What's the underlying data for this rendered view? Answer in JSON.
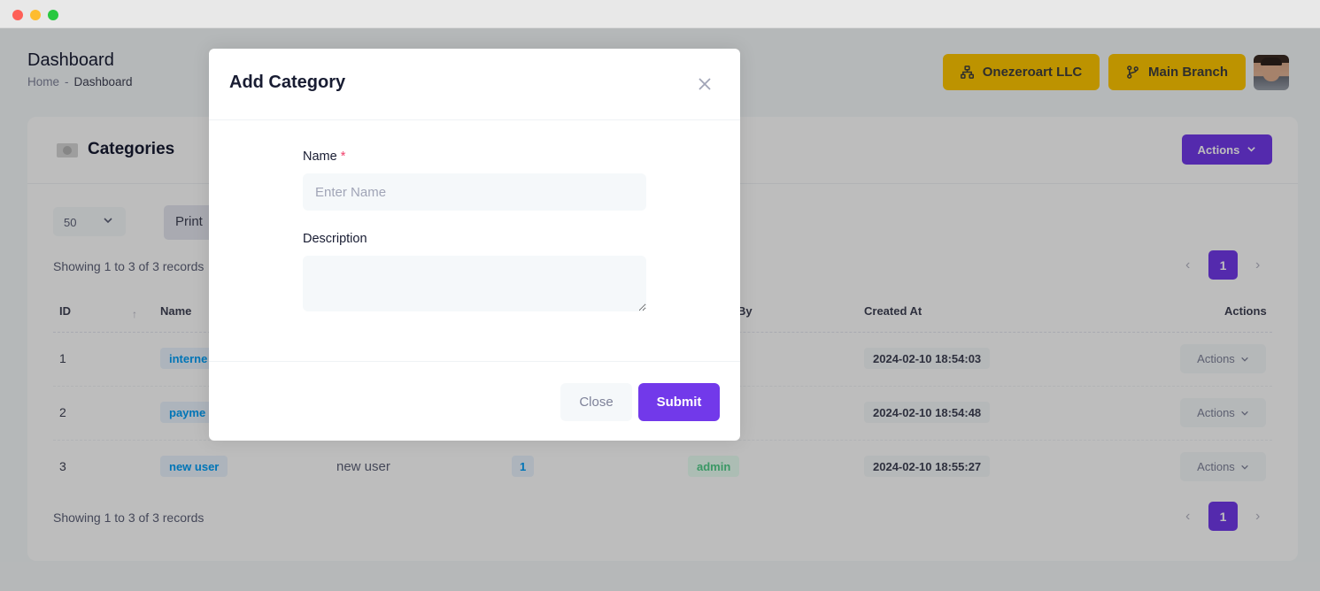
{
  "header": {
    "title": "Dashboard",
    "breadcrumb": {
      "home": "Home",
      "separator": "-",
      "current": "Dashboard"
    },
    "company_label": "Onezeroart LLC",
    "branch_label": "Main Branch"
  },
  "card": {
    "title": "Categories",
    "actions_label": "Actions"
  },
  "toolbar": {
    "page_size": "50",
    "print_label": "Print"
  },
  "summary": {
    "top": "Showing 1 to 3 of 3 records",
    "bottom": "Showing 1 to 3 of 3 records"
  },
  "pagination": {
    "current_page": "1"
  },
  "table": {
    "columns": [
      "ID",
      "Name",
      "By",
      "Created At",
      "Actions"
    ],
    "rows": [
      {
        "id": "1",
        "name": "interne",
        "description": "",
        "count": "",
        "created_by": "",
        "created_at": "2024-02-10 18:54:03",
        "action": "Actions"
      },
      {
        "id": "2",
        "name": "payme",
        "description": "",
        "count": "",
        "created_by": "",
        "created_at": "2024-02-10 18:54:48",
        "action": "Actions"
      },
      {
        "id": "3",
        "name": "new user",
        "description": "new user",
        "count": "1",
        "created_by": "admin",
        "created_at": "2024-02-10 18:55:27",
        "action": "Actions"
      }
    ]
  },
  "modal": {
    "title": "Add Category",
    "name_label": "Name",
    "required_mark": "*",
    "name_placeholder": "Enter Name",
    "name_value": "",
    "description_label": "Description",
    "description_value": "",
    "close_label": "Close",
    "submit_label": "Submit"
  },
  "colors": {
    "primary": "#7239ea",
    "warning": "#ffc700",
    "info": "#009ef7",
    "success": "#50cd89",
    "danger": "#f1416c"
  },
  "icons": {
    "company": "sitemap-icon",
    "branch": "git-branch-icon",
    "card": "category-image-icon",
    "close": "close-icon",
    "chevron": "chevron-down-icon",
    "sort": "sort-up-icon",
    "prev": "chevron-left-icon",
    "next": "chevron-right-icon"
  }
}
